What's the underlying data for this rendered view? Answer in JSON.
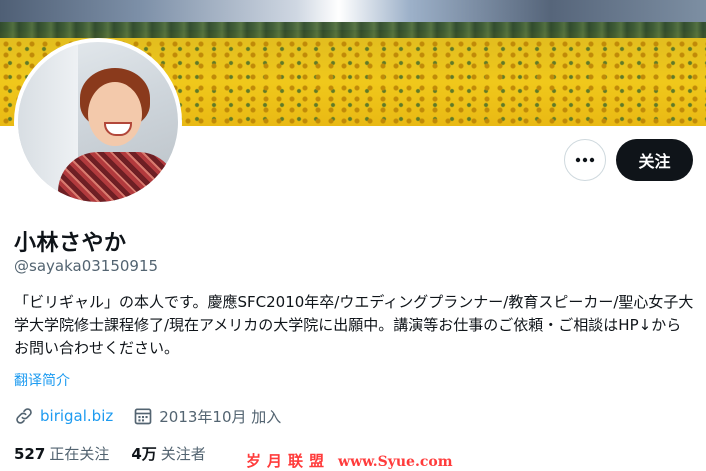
{
  "profile": {
    "name": "小林さやか",
    "handle": "@sayaka03150915",
    "bio": "「ビリギャル」の本人です。慶應SFC2010年卒/ウエディングプランナー/教育スピーカー/聖心女子大学大学院修士課程修了/現在アメリカの大学院に出願中。講演等お仕事のご依頼・ご相談はHP↓からお問い合わせください。",
    "translate_label": "翻译简介",
    "website": "birigal.biz",
    "joined": "2013年10月 加入"
  },
  "actions": {
    "more_label": "•••",
    "follow_label": "关注"
  },
  "stats": {
    "following_count": "527",
    "following_label": "正在关注",
    "followers_count": "4万",
    "followers_label": "关注者"
  },
  "watermark": {
    "text": "岁月联盟",
    "url": "www.Syue.com"
  },
  "colors": {
    "accent": "#1d9bf0",
    "text": "#0f1419",
    "muted": "#536471",
    "button_dark": "#0f1419"
  },
  "icons": [
    "link-icon",
    "calendar-icon",
    "more-icon"
  ]
}
